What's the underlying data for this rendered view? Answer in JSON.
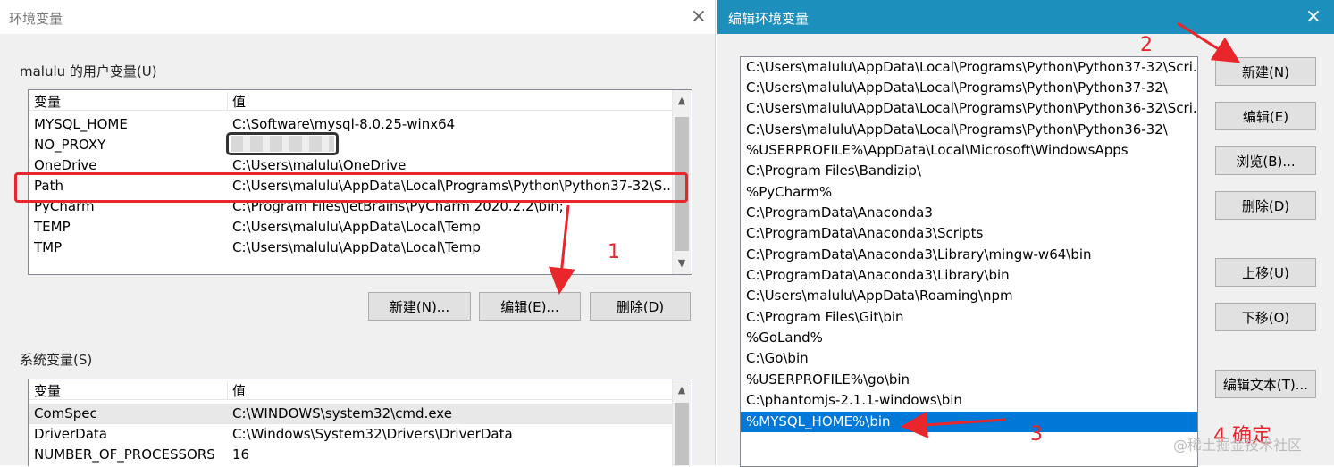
{
  "left_window": {
    "title": "环境变量",
    "close_glyph": "×",
    "user_vars_label": "malulu 的用户变量(U)",
    "user_table": {
      "col_name": "变量",
      "col_value": "值",
      "rows": [
        {
          "name": "MYSQL_HOME",
          "value": "C:\\Software\\mysql-8.0.25-winx64"
        },
        {
          "name": "NO_PROXY",
          "value": ""
        },
        {
          "name": "OneDrive",
          "value": "C:\\Users\\malulu\\OneDrive"
        },
        {
          "name": "Path",
          "value": "C:\\Users\\malulu\\AppData\\Local\\Programs\\Python\\Python37-32\\S..."
        },
        {
          "name": "PyCharm",
          "value": "C:\\Program Files\\JetBrains\\PyCharm 2020.2.2\\bin;"
        },
        {
          "name": "TEMP",
          "value": "C:\\Users\\malulu\\AppData\\Local\\Temp"
        },
        {
          "name": "TMP",
          "value": "C:\\Users\\malulu\\AppData\\Local\\Temp"
        }
      ]
    },
    "buttons": {
      "new": "新建(N)...",
      "edit": "编辑(E)...",
      "delete": "删除(D)"
    },
    "system_vars_label": "系统变量(S)",
    "system_table": {
      "col_name": "变量",
      "col_value": "值",
      "rows": [
        {
          "name": "ComSpec",
          "value": "C:\\WINDOWS\\system32\\cmd.exe"
        },
        {
          "name": "DriverData",
          "value": "C:\\Windows\\System32\\Drivers\\DriverData"
        },
        {
          "name": "NUMBER_OF_PROCESSORS",
          "value": "16"
        }
      ]
    },
    "scroll_up_glyph": "▲",
    "scroll_down_glyph": "▼"
  },
  "right_window": {
    "title": "编辑环境变量",
    "close_glyph": "×",
    "path_entries": [
      "C:\\Users\\malulu\\AppData\\Local\\Programs\\Python\\Python37-32\\Scri...",
      "C:\\Users\\malulu\\AppData\\Local\\Programs\\Python\\Python37-32\\",
      "C:\\Users\\malulu\\AppData\\Local\\Programs\\Python\\Python36-32\\Scri...",
      "C:\\Users\\malulu\\AppData\\Local\\Programs\\Python\\Python36-32\\",
      "%USERPROFILE%\\AppData\\Local\\Microsoft\\WindowsApps",
      "C:\\Program Files\\Bandizip\\",
      "%PyCharm%",
      "C:\\ProgramData\\Anaconda3",
      "C:\\ProgramData\\Anaconda3\\Scripts",
      "C:\\ProgramData\\Anaconda3\\Library\\mingw-w64\\bin",
      "C:\\ProgramData\\Anaconda3\\Library\\bin",
      "C:\\Users\\malulu\\AppData\\Roaming\\npm",
      "C:\\Program Files\\Git\\bin",
      "%GoLand%",
      "C:\\Go\\bin",
      "%USERPROFILE%\\go\\bin",
      "C:\\phantomjs-2.1.1-windows\\bin",
      "%MYSQL_HOME%\\bin"
    ],
    "selected_index": 17,
    "buttons": {
      "new": "新建(N)",
      "edit": "编辑(E)",
      "browse": "浏览(B)...",
      "delete": "删除(D)",
      "move_up": "上移(U)",
      "move_down": "下移(O)",
      "edit_text": "编辑文本(T)..."
    }
  },
  "annotations": {
    "step1": "1",
    "step2": "2",
    "step3": "3",
    "step4": "4 确定",
    "color": "#e8262b"
  },
  "watermark": "@稀土掘金技术社区",
  "colors": {
    "titlebar_active": "#1c8fbd",
    "selection": "#0078d7",
    "dialog_bg": "#f0f0f0"
  }
}
